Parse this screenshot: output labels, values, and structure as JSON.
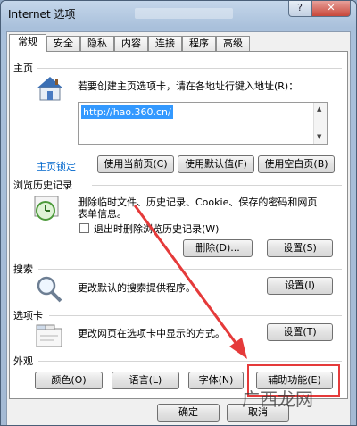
{
  "window": {
    "title": "Internet 选项",
    "help_label": "?",
    "close_label": "✕"
  },
  "tabs": [
    "常规",
    "安全",
    "隐私",
    "内容",
    "连接",
    "程序",
    "高级"
  ],
  "home": {
    "section": "主页",
    "desc": "若要创建主页选项卡，请在各地址行键入地址(R)：",
    "url": "http://hao.360.cn/",
    "lock_link": "主页锁定",
    "btn_current": "使用当前页(C)",
    "btn_default": "使用默认值(F)",
    "btn_blank": "使用空白页(B)"
  },
  "history": {
    "section": "浏览历史记录",
    "desc_line1": "删除临时文件、历史记录、Cookie、保存的密码和网页",
    "desc_line2": "表单信息。",
    "checkbox": "退出时删除浏览历史记录(W)",
    "btn_delete": "删除(D)...",
    "btn_settings": "设置(S)"
  },
  "search": {
    "section": "搜索",
    "desc": "更改默认的搜索提供程序。",
    "btn_settings": "设置(I)"
  },
  "tabsec": {
    "section": "选项卡",
    "desc": "更改网页在选项卡中显示的方式。",
    "btn_settings": "设置(T)"
  },
  "appearance": {
    "section": "外观",
    "btn_colors": "颜色(O)",
    "btn_languages": "语言(L)",
    "btn_fonts": "字体(N)",
    "btn_accessibility": "辅助功能(E)"
  },
  "footer": {
    "btn_ok": "确定",
    "btn_cancel": "取消"
  },
  "watermark": "广西龙网",
  "colors": {
    "annotation": "#e53a3a",
    "link": "#0066cc",
    "selection": "#3399ff"
  }
}
